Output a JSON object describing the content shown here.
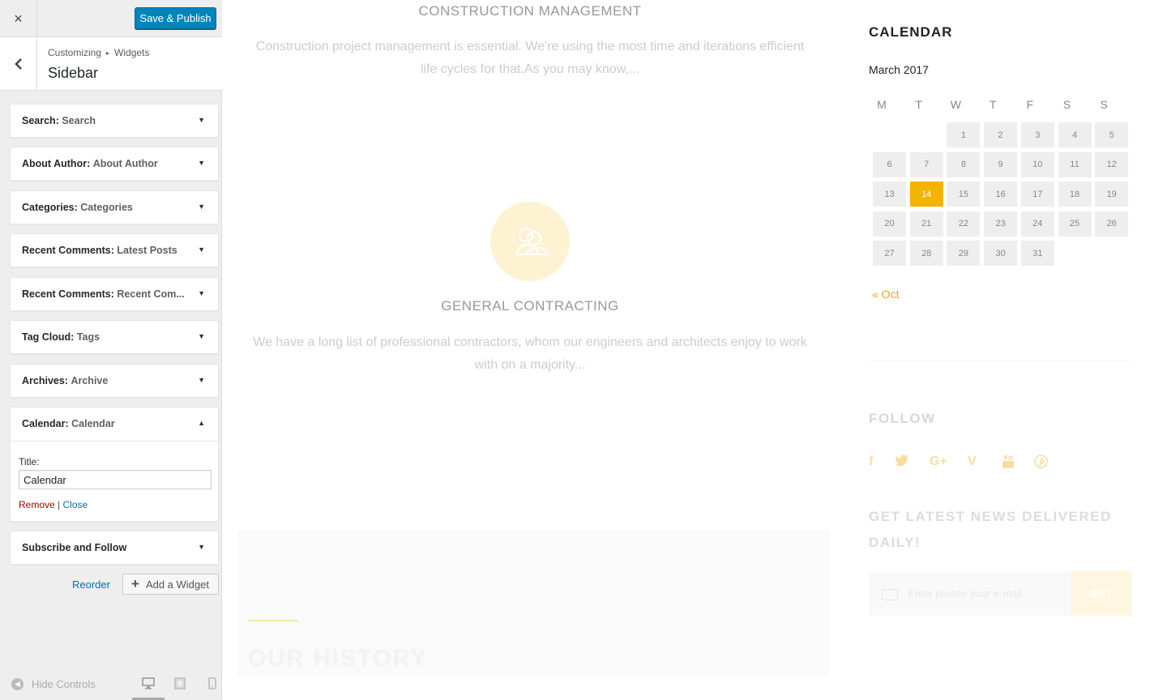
{
  "customizer": {
    "close_icon": "×",
    "publish_label": "Save & Publish",
    "back_icon": "‹",
    "breadcrumb": {
      "parent": "Customizing",
      "separator": "▸",
      "child": "Widgets"
    },
    "section_title": "Sidebar",
    "widgets": [
      {
        "type": "Search:",
        "title": "Search",
        "arrow": "▼"
      },
      {
        "type": "About Author:",
        "title": "About Author",
        "arrow": "▼"
      },
      {
        "type": "Categories:",
        "title": "Categories",
        "arrow": "▼"
      },
      {
        "type": "Recent Comments:",
        "title": "Latest Posts",
        "arrow": "▼"
      },
      {
        "type": "Recent Comments:",
        "title": "Recent Com...",
        "arrow": "▼"
      },
      {
        "type": "Tag Cloud:",
        "title": "Tags",
        "arrow": "▼"
      },
      {
        "type": "Archives:",
        "title": "Archive",
        "arrow": "▼"
      },
      {
        "type": "Calendar:",
        "title": "Calendar",
        "arrow": "▲"
      },
      {
        "type": "Subscribe and Follow",
        "title": "",
        "arrow": "▼"
      }
    ],
    "open_widget": {
      "field_label": "Title:",
      "field_value": "Calendar",
      "remove_label": "Remove",
      "divider": "|",
      "close_label": "Close"
    },
    "reorder_label": "Reorder",
    "add_widget_label": "Add a Widget",
    "hide_controls_label": "Hide Controls"
  },
  "preview": {
    "services": [
      {
        "title": "CONSTRUCTION MANAGEMENT",
        "text": "Construction project management is essential. We're using the most time and iterations efficient life cycles for that.As you may know,..."
      },
      {
        "title": "GENERAL CONTRACTING",
        "text": "We have a long list of professional contractors, whom our engineers and architects enjoy to work with on a majority..."
      }
    ],
    "history_title": "OUR HISTORY",
    "calendar": {
      "heading": "CALENDAR",
      "month": "March 2017",
      "weekdays": [
        "M",
        "T",
        "W",
        "T",
        "F",
        "S",
        "S"
      ],
      "first_weekday_index": 2,
      "days_in_month": 31,
      "today": 14,
      "today_color": "#f5b400",
      "prev_link": "« Oct"
    },
    "follow": {
      "heading": "FOLLOW",
      "icons": [
        "facebook-icon",
        "twitter-icon",
        "google-plus-icon",
        "vimeo-icon",
        "youtube-icon",
        "pinterest-icon"
      ]
    },
    "newsletter": {
      "heading": "GET LATEST NEWS DELIVERED DAILY!",
      "placeholder": "Enter please your e-mail",
      "button": "GET"
    }
  }
}
